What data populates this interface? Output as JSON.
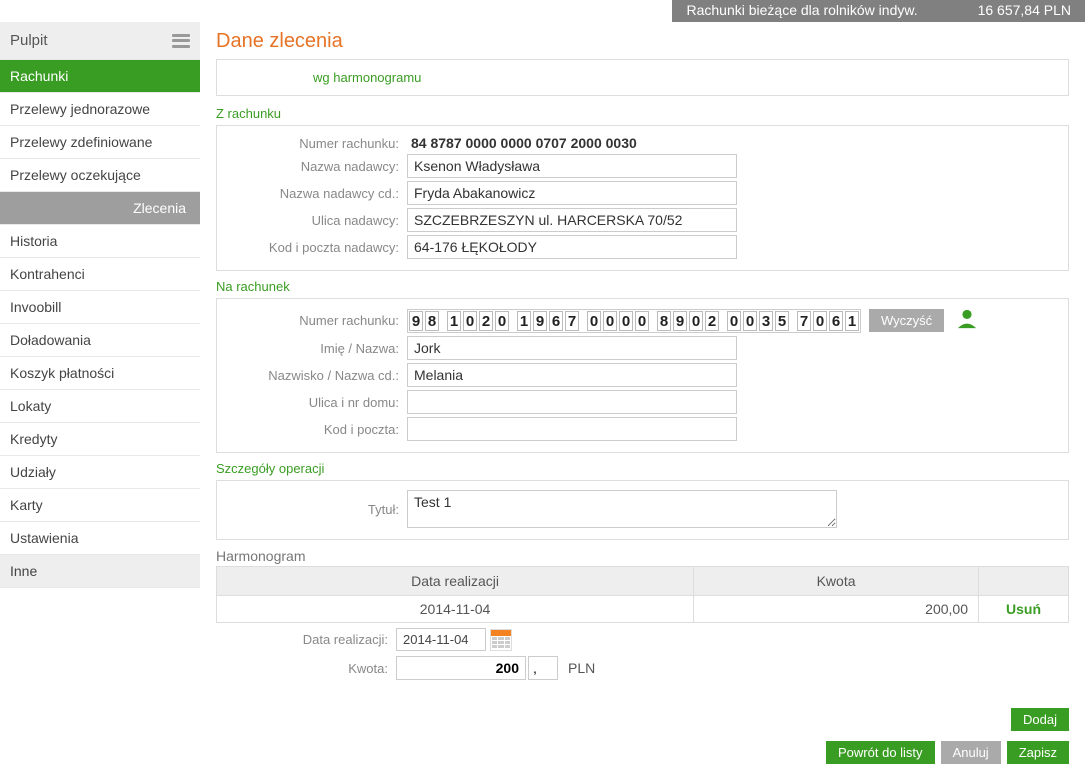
{
  "header": {
    "account_name": "Rachunki bieżące dla rolników indyw.",
    "balance": "16 657,84 PLN"
  },
  "sidebar": {
    "pulpit": "Pulpit",
    "items": [
      "Rachunki",
      "Przelewy jednorazowe",
      "Przelewy zdefiniowane",
      "Przelewy oczekujące",
      "Zlecenia",
      "Historia",
      "Kontrahenci",
      "Invoobill",
      "Doładowania",
      "Koszyk płatności",
      "Lokaty",
      "Kredyty",
      "Udziały",
      "Karty",
      "Ustawienia",
      "Inne"
    ]
  },
  "page": {
    "title": "Dane zlecenia",
    "tab": "wg harmonogramu"
  },
  "from": {
    "section": "Z rachunku",
    "labels": {
      "nr": "Numer rachunku:",
      "name": "Nazwa nadawcy:",
      "name2": "Nazwa nadawcy cd.:",
      "street": "Ulica nadawcy:",
      "post": "Kod i poczta nadawcy:"
    },
    "nr": "84 8787 0000 0000 0707 2000 0030",
    "name": "Ksenon Władysława",
    "name2": "Fryda Abakanowicz",
    "street": "SZCZEBRZESZYN ul. HARCERSKA 70/52",
    "post": "64-176 ŁĘKOŁODY"
  },
  "to": {
    "section": "Na rachunek",
    "labels": {
      "nr": "Numer rachunku:",
      "name": "Imię / Nazwa:",
      "name2": "Nazwisko / Nazwa cd.:",
      "street": "Ulica i nr domu:",
      "post": "Kod i poczta:"
    },
    "digits": [
      "9",
      "8",
      "1",
      "0",
      "2",
      "0",
      "1",
      "9",
      "6",
      "7",
      "0",
      "0",
      "0",
      "0",
      "8",
      "9",
      "0",
      "2",
      "0",
      "0",
      "3",
      "5",
      "7",
      "0",
      "6",
      "1"
    ],
    "clear": "Wyczyść",
    "name": "Jork",
    "name2": "Melania",
    "street": "",
    "post": ""
  },
  "op": {
    "section": "Szczegóły operacji",
    "labels": {
      "title": "Tytuł:"
    },
    "title": "Test 1"
  },
  "sched": {
    "title": "Harmonogram",
    "cols": {
      "date": "Data realizacji",
      "amount": "Kwota"
    },
    "row": {
      "date": "2014-11-04",
      "amount": "200,00",
      "del": "Usuń"
    },
    "labels": {
      "date": "Data realizacji:",
      "amount": "Kwota:"
    },
    "date_input": "2014-11-04",
    "amount_input": "200",
    "amount_dec": ",",
    "currency": "PLN"
  },
  "buttons": {
    "add": "Dodaj",
    "back": "Powrót do listy",
    "cancel": "Anuluj",
    "save": "Zapisz"
  }
}
